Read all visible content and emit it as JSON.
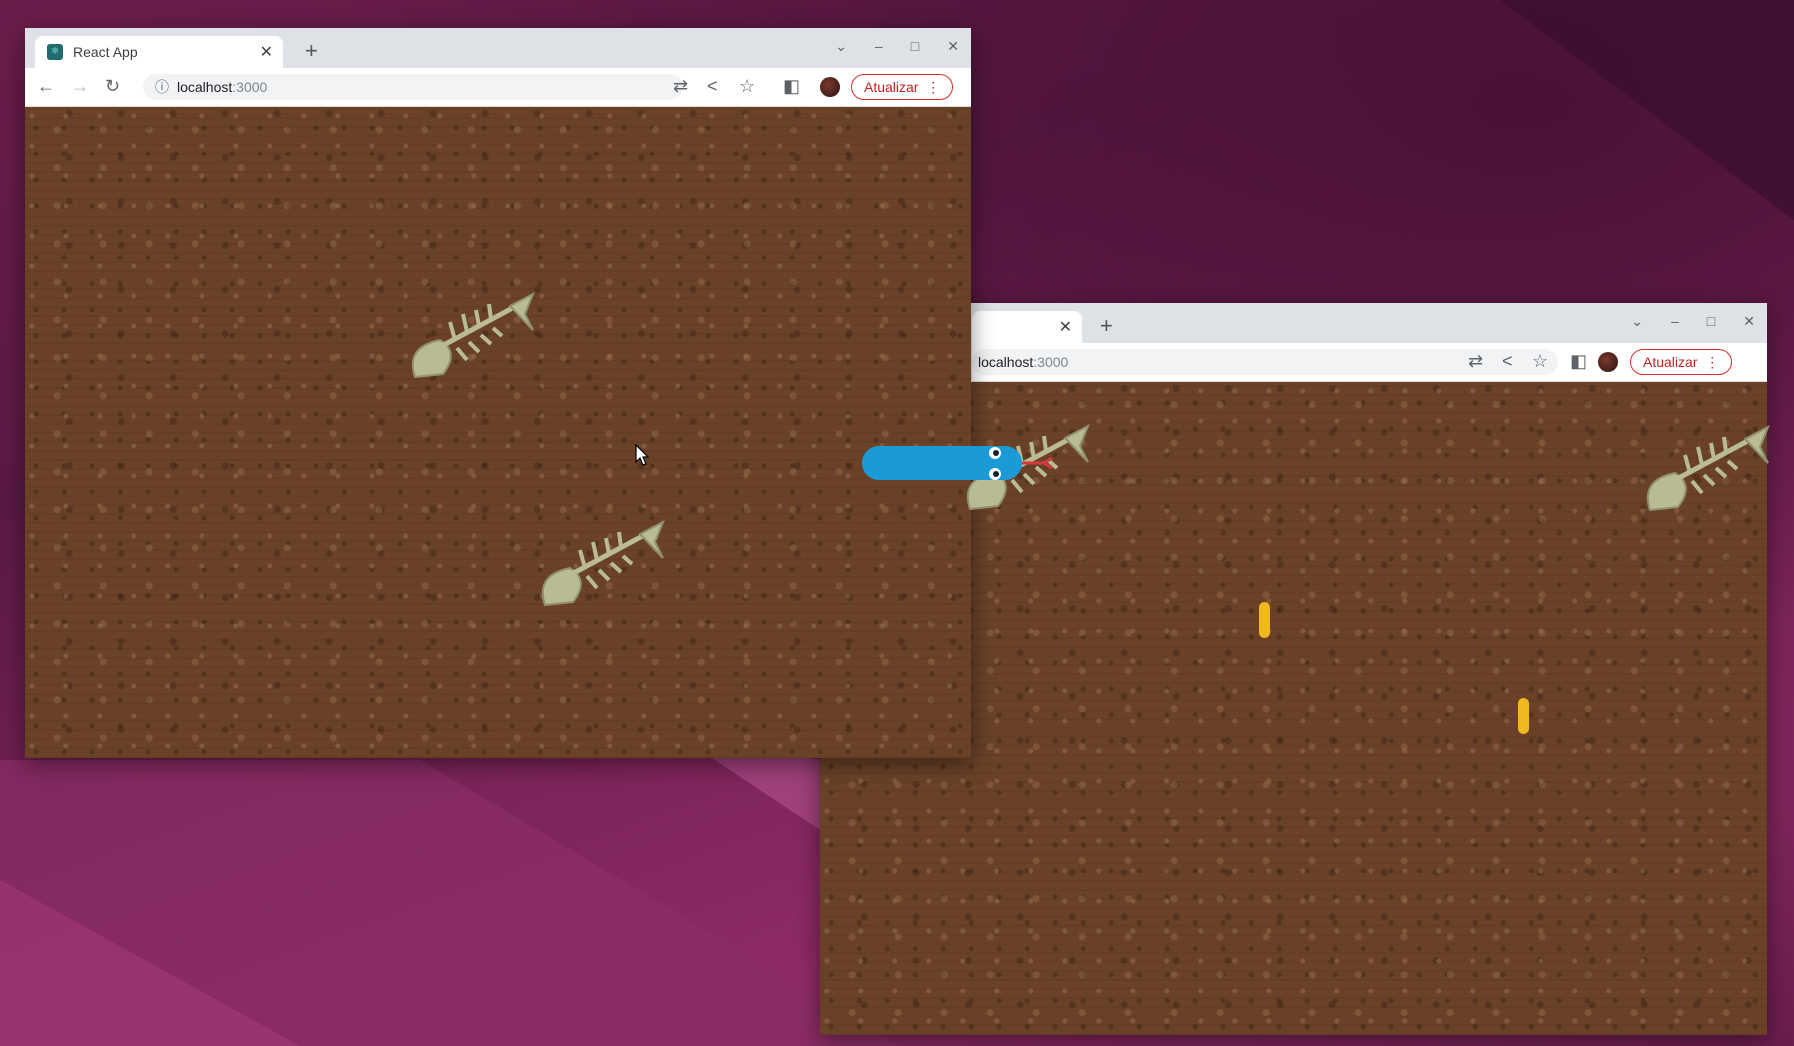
{
  "desktop": {
    "wallpaper": "purple-gradient"
  },
  "window_left": {
    "tab_title": "React App",
    "url_host": "localhost",
    "url_port": ":3000",
    "update_button": "Atualizar",
    "game": {
      "fish_skeletons": 2,
      "cursor": true
    }
  },
  "window_right": {
    "url_host": "localhost",
    "url_port": ":3000",
    "update_button": "Atualizar",
    "game": {
      "fish_skeletons": 2,
      "food_pellets": 2
    }
  },
  "snake": {
    "color": "#1a9bd7",
    "tongue_color": "#d33b3b"
  },
  "colors": {
    "dirt": "#6b4228",
    "fish": "#b9bb95",
    "pellet": "#f2b81f"
  }
}
